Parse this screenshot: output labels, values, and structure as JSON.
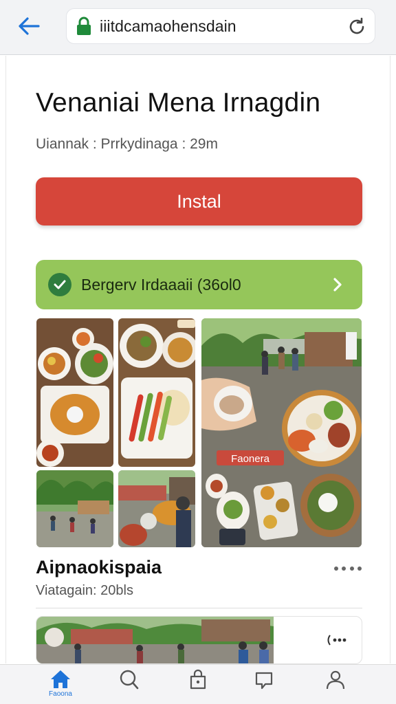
{
  "browser": {
    "url": "iiitdcamaohensdain"
  },
  "app": {
    "title": "Venaniai Mena Irnagdin",
    "meta": "Uiannak : Prrkydinaga : 29m",
    "install_label": "Instal"
  },
  "banner": {
    "text": "Bergerv Irdaaaii (36ol0"
  },
  "gallery": {
    "overlay_label": "Faonera"
  },
  "section": {
    "title": "Aipnaokispaia",
    "subtitle": "Viatagain: 20bls"
  },
  "bottom_nav": {
    "home_label": "Faoona"
  },
  "colors": {
    "install": "#d6463a",
    "banner": "#95c65a",
    "accent": "#1e73d8",
    "label_bg": "#c94a3c"
  }
}
